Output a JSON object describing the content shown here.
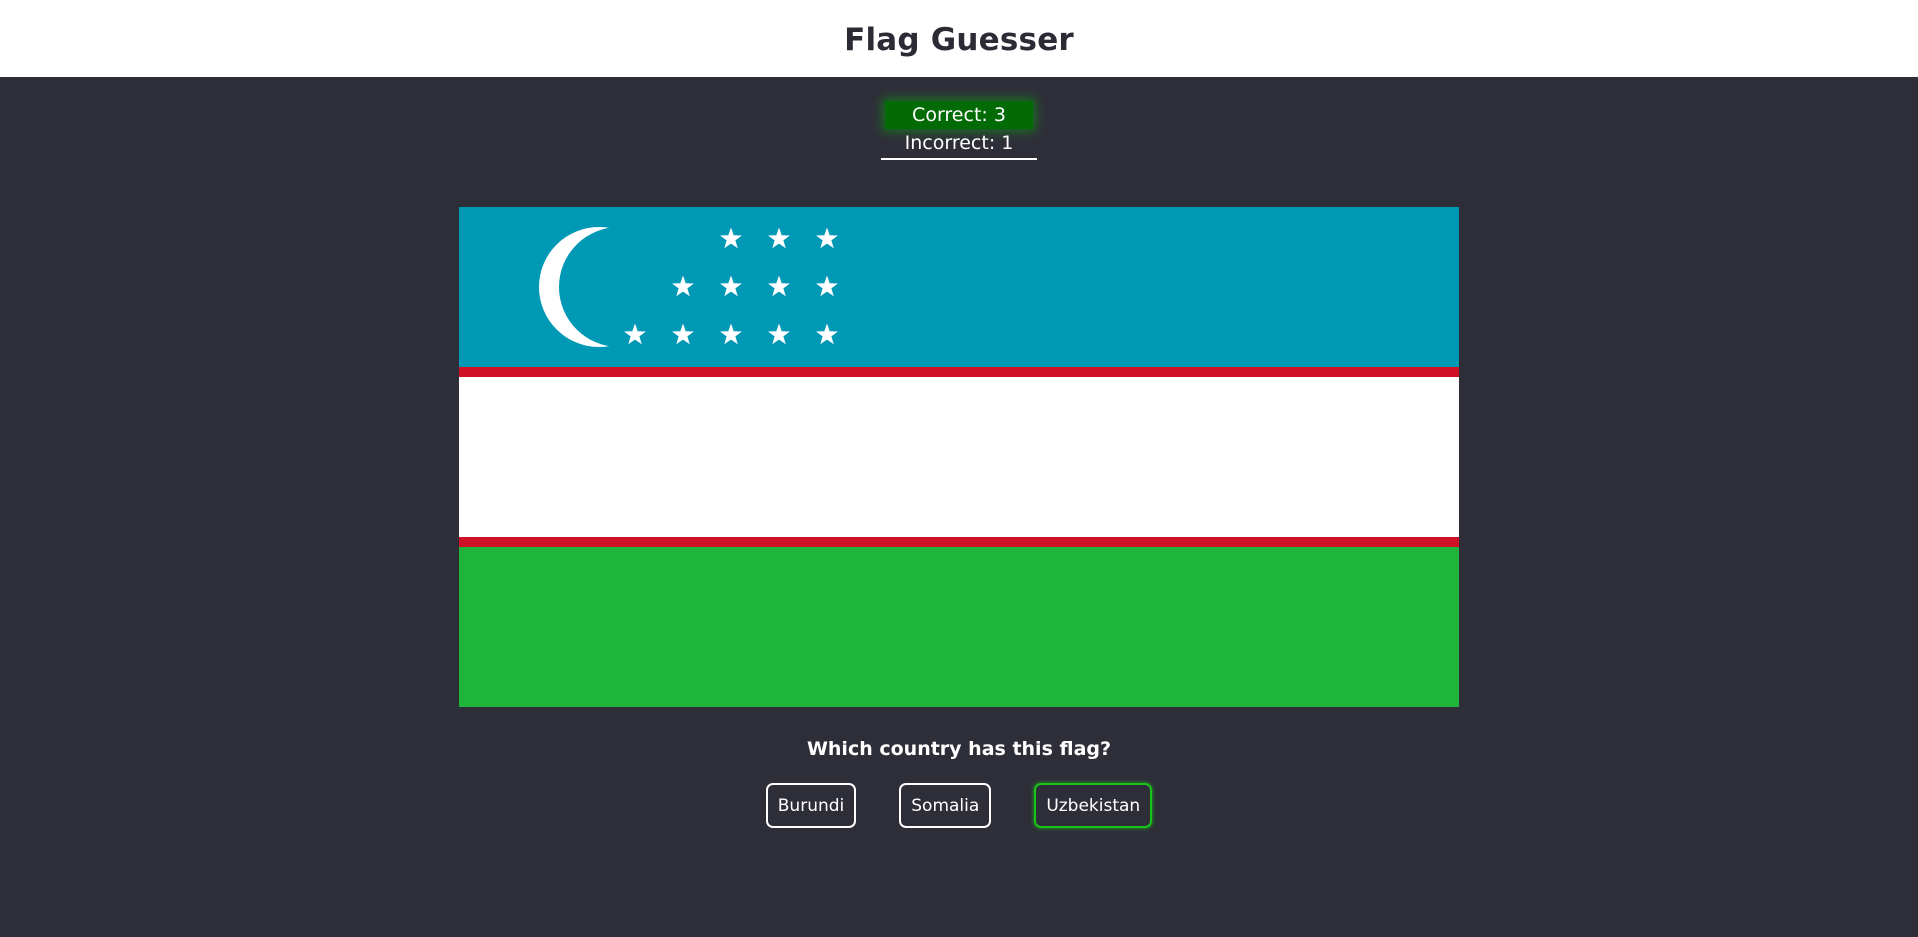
{
  "header": {
    "title": "Flag Guesser"
  },
  "score": {
    "correct_label": "Correct: 3",
    "incorrect_label": "Incorrect: 1"
  },
  "flag": {
    "colors": {
      "blue": "#0099b5",
      "red": "#ce1126",
      "white": "#ffffff",
      "green": "#1eb53a"
    }
  },
  "question": {
    "text": "Which country has this flag?"
  },
  "options": [
    {
      "label": "Burundi",
      "state": "neutral"
    },
    {
      "label": "Somalia",
      "state": "neutral"
    },
    {
      "label": "Uzbekistan",
      "state": "correct"
    }
  ],
  "colors": {
    "background": "#2e2e39",
    "header_background": "#ffffff",
    "correct_badge": "#036b05",
    "correct_border": "#18c418"
  }
}
